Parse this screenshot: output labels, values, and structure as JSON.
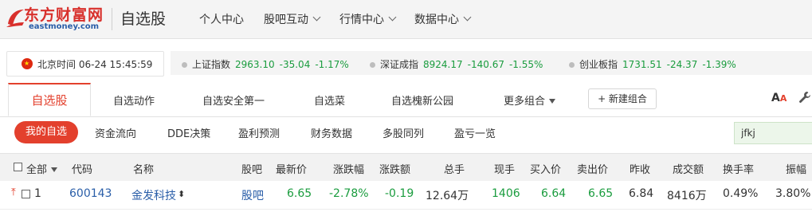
{
  "header": {
    "logo_cn": "东方财富网",
    "logo_en": "eastmoney.com",
    "page_title": "自选股",
    "nav": [
      {
        "label": "个人中心",
        "dropdown": false
      },
      {
        "label": "股吧互动",
        "dropdown": true
      },
      {
        "label": "行情中心",
        "dropdown": true
      },
      {
        "label": "数据中心",
        "dropdown": true
      }
    ]
  },
  "clock": {
    "label": "北京时间",
    "date": "06-24",
    "time": "15:45:59",
    "flag_icon": "china-flag-icon"
  },
  "indices": [
    {
      "name": "上证指数",
      "price": "2963.10",
      "change": "-35.04",
      "pct": "-1.17%"
    },
    {
      "name": "深证成指",
      "price": "8924.17",
      "change": "-140.67",
      "pct": "-1.55%"
    },
    {
      "name": "创业板指",
      "price": "1731.51",
      "change": "-24.37",
      "pct": "-1.39%"
    }
  ],
  "group_tabs": {
    "active": "自选股",
    "items": [
      "自选动作",
      "自选安全第一",
      "自选菜",
      "自选槐新公园",
      "更多组合"
    ],
    "new_group": "+ 新建组合",
    "font_size_large": "A",
    "font_size_small": "A"
  },
  "sub_tabs": {
    "active": "我的自选",
    "items": [
      "资金流向",
      "DDE决策",
      "盈利预测",
      "财务数据",
      "多股同列",
      "盈亏一览"
    ]
  },
  "search": {
    "value": "jfkj"
  },
  "table": {
    "headers": [
      "全部",
      "代码",
      "名称",
      "股吧",
      "最新价",
      "涨跌幅",
      "涨跌额",
      "总手",
      "现手",
      "买入价",
      "卖出价",
      "昨收",
      "成交额",
      "换手率",
      "振幅"
    ],
    "rows": [
      {
        "index": "1",
        "code": "600143",
        "name": "金发科技",
        "guba": "股吧",
        "last": "6.65",
        "pct": "-2.78%",
        "chg": "-0.19",
        "volume": "12.64万",
        "cur_vol": "1406",
        "bid": "6.64",
        "ask": "6.65",
        "prev_close": "6.84",
        "turnover": "8416万",
        "turnover_rate": "0.49%",
        "amplitude": "3.80%"
      }
    ]
  },
  "colors": {
    "accent": "#e3402d",
    "down": "#1a9c3e",
    "link": "#2a5ea8"
  }
}
